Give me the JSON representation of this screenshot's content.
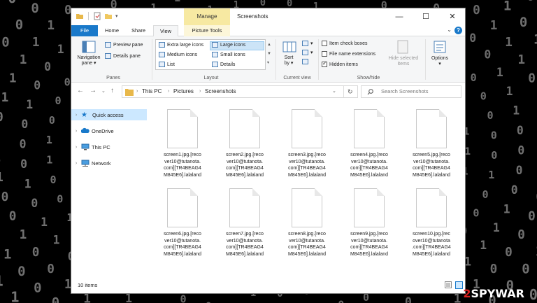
{
  "window": {
    "title": "Screenshots",
    "context_tab": "Manage",
    "controls": {
      "minimize": "—",
      "maximize": "☐",
      "close": "✕"
    }
  },
  "ribbon_tabs": [
    "File",
    "Home",
    "Share",
    "View",
    "Picture Tools"
  ],
  "ribbon": {
    "panes": {
      "navigation_pane": "Navigation\npane ▾",
      "preview_pane": "Preview pane",
      "details_pane": "Details pane",
      "group_label": "Panes"
    },
    "layout": {
      "items": [
        "Extra large icons",
        "Large icons",
        "Medium icons",
        "Small icons",
        "List",
        "Details"
      ],
      "selected": "Large icons",
      "group_label": "Layout"
    },
    "current_view": {
      "sort_by": "Sort\nby ▾",
      "group_label": "Current view"
    },
    "show_hide": {
      "item_check_boxes": "Item check boxes",
      "file_name_extensions": "File name extensions",
      "hidden_items": "Hidden items",
      "hide_selected": "Hide selected\nitems",
      "group_label": "Show/hide"
    },
    "options": "Options\n▾"
  },
  "address": {
    "crumbs": [
      "This PC",
      "Pictures",
      "Screenshots"
    ],
    "search_placeholder": "Search Screenshots"
  },
  "nav_pane": [
    {
      "label": "Quick access",
      "selected": true
    },
    {
      "label": "OneDrive",
      "selected": false
    },
    {
      "label": "This PC",
      "selected": false
    },
    {
      "label": "Network",
      "selected": false
    }
  ],
  "files": [
    {
      "line1": "screen1.jpg.[reco",
      "line2": "ver10@tutanota.",
      "line3": "com][TR4BEAG4",
      "line4": "M845E6].lalaland"
    },
    {
      "line1": "screen2.jpg.[reco",
      "line2": "ver10@tutanota.",
      "line3": "com][TR4BEAG4",
      "line4": "M845E6].lalaland"
    },
    {
      "line1": "screen3.jpg.[reco",
      "line2": "ver10@tutanota.",
      "line3": "com][TR4BEAG4",
      "line4": "M845E6].lalaland"
    },
    {
      "line1": "screen4.jpg.[reco",
      "line2": "ver10@tutanota.",
      "line3": "com][TR4BEAG4",
      "line4": "M845E6].lalaland"
    },
    {
      "line1": "screen5.jpg.[reco",
      "line2": "ver10@tutanota.",
      "line3": "com][TR4BEAG4",
      "line4": "M845E6].lalaland"
    },
    {
      "line1": "screen6.jpg.[reco",
      "line2": "ver10@tutanota.",
      "line3": "com][TR4BEAG4",
      "line4": "M845E6].lalaland"
    },
    {
      "line1": "screen7.jpg.[reco",
      "line2": "ver10@tutanota.",
      "line3": "com][TR4BEAG4",
      "line4": "M845E6].lalaland"
    },
    {
      "line1": "screen8.jpg.[reco",
      "line2": "ver10@tutanota.",
      "line3": "com][TR4BEAG4",
      "line4": "M845E6].lalaland"
    },
    {
      "line1": "screen9.jpg.[reco",
      "line2": "ver10@tutanota.",
      "line3": "com][TR4BEAG4",
      "line4": "M845E6].lalaland"
    },
    {
      "line1": "screen10.jpg.[rec",
      "line2": "over10@tutanota",
      "line3": ".com][TR4BEAG4",
      "line4": "M845E6].lalaland"
    }
  ],
  "status": {
    "item_count": "10 items"
  },
  "watermark": {
    "prefix": "2",
    "brand": "SPYWAR"
  },
  "colors": {
    "accent": "#1979ca",
    "context": "#f7e9a2",
    "selection": "#cce8ff"
  }
}
